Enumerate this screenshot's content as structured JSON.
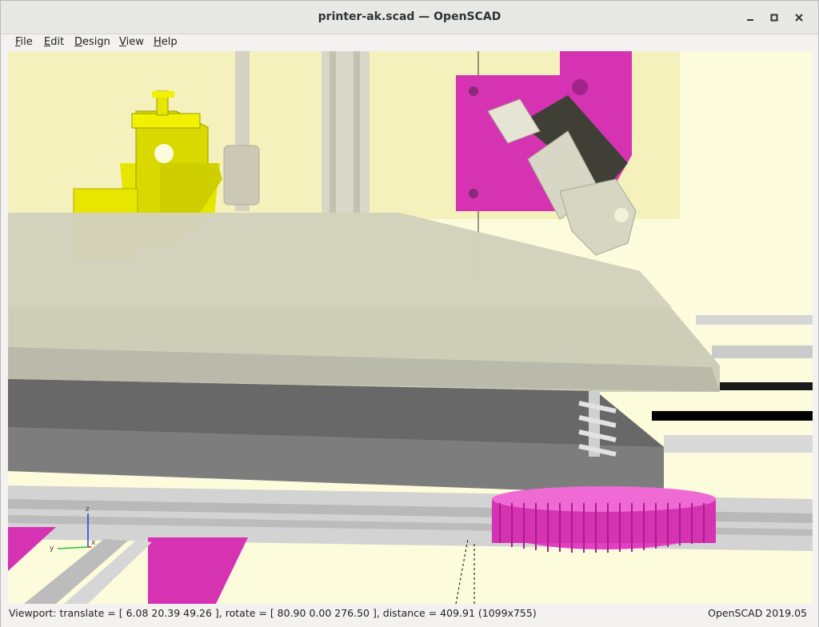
{
  "window": {
    "title": "printer-ak.scad — OpenSCAD",
    "minimize_icon": "minimize-icon",
    "maximize_icon": "maximize-icon",
    "close_icon": "close-icon"
  },
  "menu": {
    "items": [
      {
        "label": "File",
        "accel": "F"
      },
      {
        "label": "Edit",
        "accel": "E"
      },
      {
        "label": "Design",
        "accel": "D"
      },
      {
        "label": "View",
        "accel": "V"
      },
      {
        "label": "Help",
        "accel": "H"
      }
    ]
  },
  "viewport": {
    "background_color": "#fcfbdc",
    "axes": {
      "x_label": "x",
      "y_label": "y",
      "z_label": "z"
    },
    "colors": {
      "print_part_yellow": "#e6e600",
      "magenta_parts": "#d633b3",
      "bed_plate_gray": "#7d7d7d",
      "glass_bed": "#c9c9b4",
      "extrusions": "#cfcfcf"
    }
  },
  "status": {
    "viewport_text": "Viewport: translate = [ 6.08 20.39 49.26 ], rotate = [ 80.90 0.00 276.50 ], distance = 409.91 (1099x755)",
    "version": "OpenSCAD 2019.05"
  }
}
